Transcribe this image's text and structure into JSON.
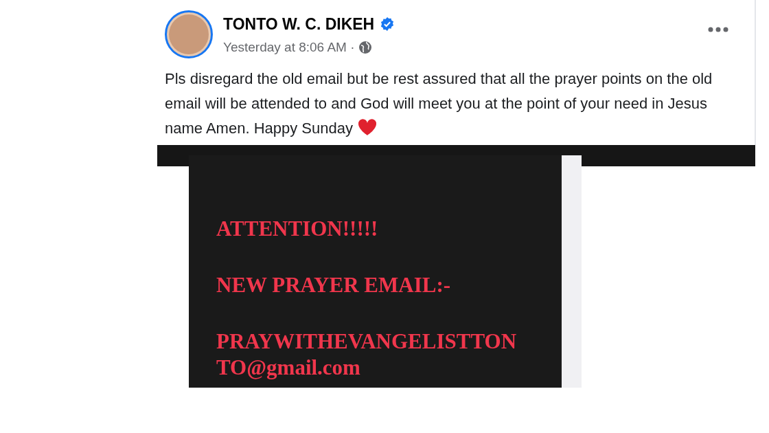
{
  "post": {
    "author": "TONTO W. C. DIKEH",
    "verified": true,
    "timestamp": "Yesterday at 8:06 AM ·",
    "text": "Pls disregard the old email but be rest assured that all the prayer points on the old email will be attended to and God will meet you at the point of your need in Jesus name Amen. Happy Sunday",
    "image_lines": [
      "ATTENTION!!!!!",
      "NEW PRAYER EMAIL:-",
      "PRAYWITHEVANGELISTTONTO@gmail.com"
    ]
  }
}
